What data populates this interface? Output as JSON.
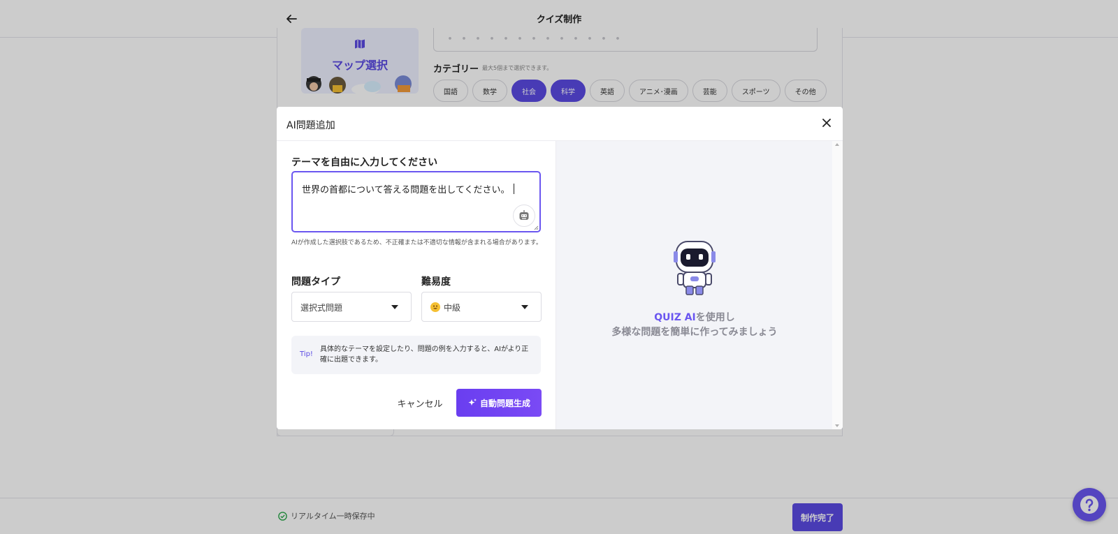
{
  "header": {
    "title": "クイズ制作"
  },
  "editor": {
    "map_label": "マップ選択",
    "category_label": "カテゴリー",
    "category_note": "最大5個まで選択できます。",
    "categories": [
      {
        "label": "国語",
        "active": false
      },
      {
        "label": "数学",
        "active": false
      },
      {
        "label": "社会",
        "active": true
      },
      {
        "label": "科学",
        "active": true
      },
      {
        "label": "英語",
        "active": false
      },
      {
        "label": "アニメ･漫画",
        "active": false
      },
      {
        "label": "芸能",
        "active": false
      },
      {
        "label": "スポーツ",
        "active": false
      },
      {
        "label": "その他",
        "active": false
      }
    ]
  },
  "footer": {
    "autosave": "リアルタイム一時保存中",
    "done_label": "制作完了"
  },
  "modal": {
    "title": "AI問題追加",
    "theme_label": "テーマを自由に入力してください",
    "theme_value": "世界の首都について答える問題を出してください。",
    "disclaimer": "AIが作成した選択肢であるため、不正確または不適切な情報が含まれる場合があります。",
    "type_label": "問題タイプ",
    "type_value": "選択式問題",
    "difficulty_label": "難易度",
    "difficulty_value": "中級",
    "tip_label": "Tip!",
    "tip_text": "具体的なテーマを設定したり、問題の例を入力すると、AIがより正確に出題できます。",
    "cancel_label": "キャンセル",
    "generate_label": "自動問題生成",
    "promo_brand": "QUIZ AI",
    "promo_line1_rest": "を使用し",
    "promo_line2": "多様な問題を簡単に作ってみましょう"
  },
  "colors": {
    "accent": "#5a4ae3",
    "accent_light": "#6a56f0"
  }
}
